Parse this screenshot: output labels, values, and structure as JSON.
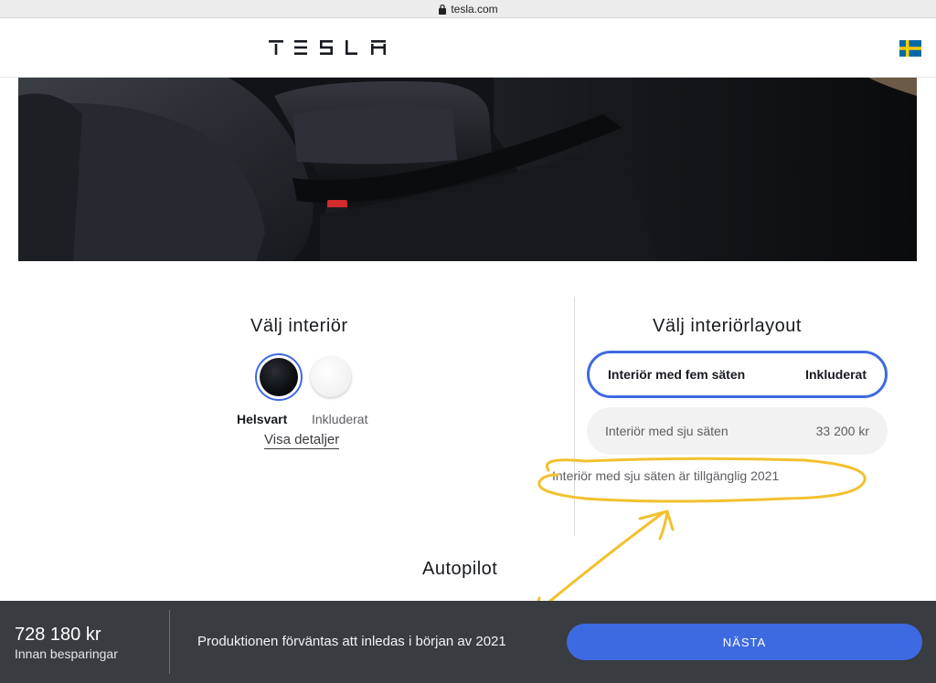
{
  "browser": {
    "url": "tesla.com"
  },
  "header": {
    "brand": "TESLA",
    "flag_icon": "sweden-flag-icon"
  },
  "interior": {
    "title": "Välj interiör",
    "selected_name": "Helsvart",
    "selected_price": "Inkluderat",
    "details_link": "Visa detaljer",
    "swatches": [
      "black",
      "white"
    ]
  },
  "layout": {
    "title": "Välj interiörlayout",
    "options": [
      {
        "label": "Interiör med fem säten",
        "price": "Inkluderat",
        "selected": true
      },
      {
        "label": "Interiör med sju säten",
        "price": "33 200 kr",
        "selected": false
      }
    ],
    "note": "Interiör med sju säten är tillgänglig 2021"
  },
  "autopilot": {
    "title": "Autopilot"
  },
  "footer": {
    "price": "728 180 kr",
    "price_sub": "Innan besparingar",
    "production_text": "Produktionen förväntas att inledas i början av 2021",
    "next_label": "NÄSTA"
  },
  "colors": {
    "accent": "#3e6ae1",
    "footer_bg": "#393c41",
    "annotation": "#f2c12e"
  }
}
